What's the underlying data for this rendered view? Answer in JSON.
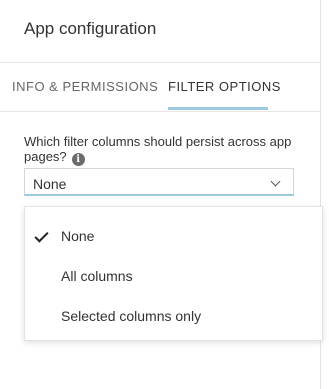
{
  "panel": {
    "title": "App configuration"
  },
  "tabs": [
    {
      "label": "INFO & PERMISSIONS",
      "active": false
    },
    {
      "label": "FILTER OPTIONS",
      "active": true
    }
  ],
  "filter": {
    "question": "Which filter columns should persist across app pages?",
    "info_icon_glyph": "i",
    "selected_value": "None"
  },
  "dropdown": {
    "options": [
      {
        "label": "None",
        "checked": true
      },
      {
        "label": "All columns",
        "checked": false
      },
      {
        "label": "Selected columns only",
        "checked": false
      }
    ]
  },
  "colors": {
    "accent": "#9ecae1",
    "text": "#333333",
    "muted": "#666666"
  }
}
